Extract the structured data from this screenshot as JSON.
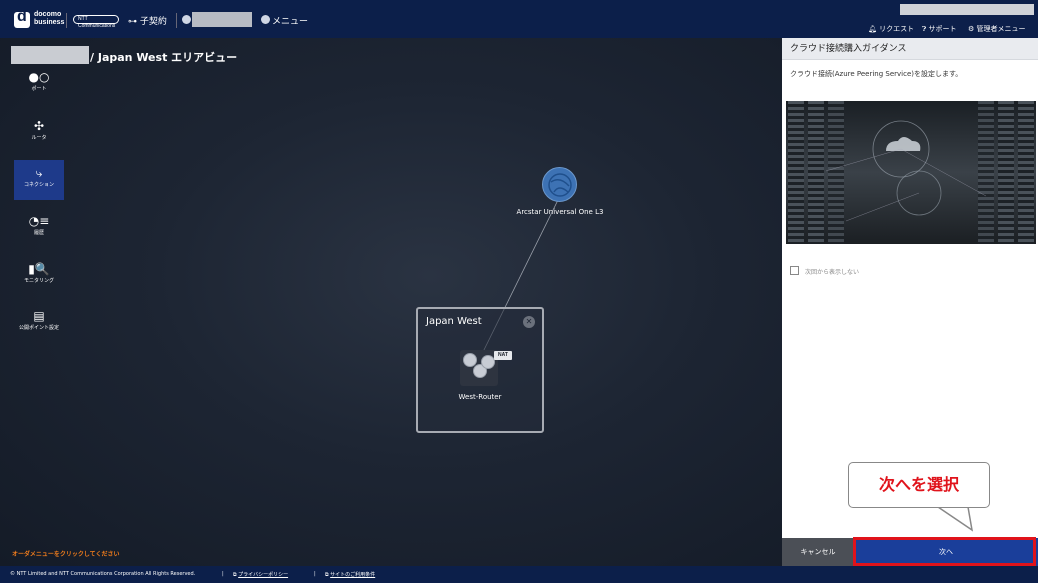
{
  "header": {
    "logo_mark": "d",
    "logo_line1": "docomo",
    "logo_line2": "business",
    "ntt_logo_text": "NTT Communications",
    "contract_label": "子契約",
    "menu_label": "メニュー",
    "request_label": "リクエスト",
    "support_label": "サポート",
    "admin_menu_label": "管理者メニュー"
  },
  "canvas": {
    "area_title": "/ Japan West エリアビュー",
    "order_hint": "オーダメニューをクリックしてください"
  },
  "sidebar": {
    "items": [
      {
        "label": "ポート",
        "icon": "port-icon",
        "glyph": "●○"
      },
      {
        "label": "ルータ",
        "icon": "router-icon",
        "glyph": "✣"
      },
      {
        "label": "コネクション",
        "icon": "connection-icon",
        "glyph": "⤷",
        "active": true
      },
      {
        "label": "履歴",
        "icon": "history-icon",
        "glyph": "◔≡"
      },
      {
        "label": "モニタリング",
        "icon": "monitoring-icon",
        "glyph": "▮🔍"
      },
      {
        "label": "公開ポイント設定",
        "icon": "public-point-icon",
        "glyph": "▤"
      }
    ]
  },
  "diagram": {
    "cloud_label": "Arcstar Universal One L3",
    "area_box_title": "Japan West",
    "router_label": "West-Router",
    "nat_badge": "NAT",
    "close_glyph": "✕"
  },
  "panel": {
    "title": "クラウド接続購入ガイダンス",
    "description": "クラウド接続(Azure Peering Service)を設定します。",
    "checkbox_label": "次回から表示しない",
    "checkbox_checked": false,
    "cancel_label": "キャンセル",
    "next_label": "次へ"
  },
  "callout": {
    "text": "次へを選択",
    "color": "#e0131b"
  },
  "footer": {
    "copyright": "© NTT Limited and NTT Communications Corporation All Rights Reserved.",
    "privacy_label": "プライバシーポリシー",
    "terms_label": "サイトのご利用条件"
  },
  "colors": {
    "header_bg": "#0c1f4a",
    "accent_blue": "#1a3e9a",
    "highlight_red": "#e0131b",
    "order_hint": "#f27d1c"
  }
}
